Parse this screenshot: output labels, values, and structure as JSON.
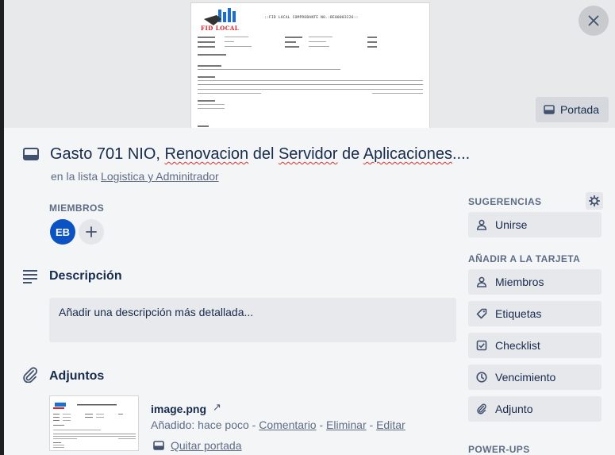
{
  "cover": {
    "doc_logo_text": "FID LOCAL",
    "doc_header": "::FID LOCAL COMPROBANTE NO.:BE00003226::",
    "button_label": "Portada"
  },
  "card": {
    "title_parts": [
      "Gasto 701 NIO, ",
      "Renovacion",
      " del ",
      "Servidor",
      " de ",
      "Aplicaciones",
      "...."
    ],
    "in_list_prefix": "en la lista",
    "list_name": "Logistica y Adminitrador"
  },
  "members": {
    "label": "MIEMBROS",
    "avatar_initials": "EB"
  },
  "description": {
    "title": "Descripción",
    "placeholder": "Añadir una descripción más detallada..."
  },
  "attachments": {
    "title": "Adjuntos",
    "file_name": "image.png",
    "added_prefix": "Añadido: hace poco - ",
    "actions": [
      "Comentario",
      "Eliminar",
      "Editar"
    ],
    "separator": " - ",
    "remove_cover": "Quitar portada"
  },
  "sidebar": {
    "suggestions_label": "SUGERENCIAS",
    "join_label": "Unirse",
    "add_to_card_label": "AÑADIR A LA TARJETA",
    "add_items": [
      {
        "label": "Miembros",
        "icon": "person-icon"
      },
      {
        "label": "Etiquetas",
        "icon": "tag-icon"
      },
      {
        "label": "Checklist",
        "icon": "checkbox-icon"
      },
      {
        "label": "Vencimiento",
        "icon": "clock-icon"
      },
      {
        "label": "Adjunto",
        "icon": "paperclip-icon"
      }
    ],
    "powerups_label": "POWER-UPS"
  }
}
